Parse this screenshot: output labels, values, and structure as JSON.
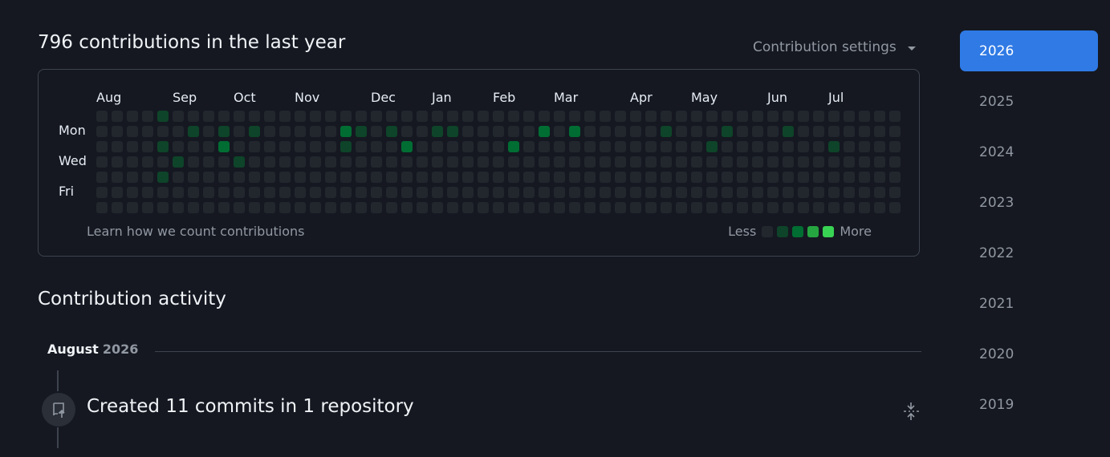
{
  "header": {
    "title": "796 contributions in the last year",
    "settings_label": "Contribution settings"
  },
  "calendar": {
    "months": [
      {
        "label": "Aug",
        "col": 0
      },
      {
        "label": "Sep",
        "col": 5
      },
      {
        "label": "Oct",
        "col": 9
      },
      {
        "label": "Nov",
        "col": 13
      },
      {
        "label": "Dec",
        "col": 18
      },
      {
        "label": "Jan",
        "col": 22
      },
      {
        "label": "Feb",
        "col": 26
      },
      {
        "label": "Mar",
        "col": 30
      },
      {
        "label": "Apr",
        "col": 35
      },
      {
        "label": "May",
        "col": 39
      },
      {
        "label": "Jun",
        "col": 44
      },
      {
        "label": "Jul",
        "col": 48
      }
    ],
    "weekdays": [
      {
        "label": "Mon",
        "row": 1
      },
      {
        "label": "Wed",
        "row": 3
      },
      {
        "label": "Fri",
        "row": 5
      }
    ],
    "colors": [
      "#22272e",
      "#0e4429",
      "#006d32",
      "#26a641",
      "#39d353"
    ],
    "levels": [
      "00001000000000000000000000000000000000000000000000000000",
      "00000010101000002101001100000202000001000100010000000000",
      "00001000200000001000200000020000000000001000000010000000",
      "00000100010000000000000000000000000000000000000000000000",
      "00001000000000000000000000000000000000000000000000000000",
      "00000000000000000000000000000000000000000000000000000000",
      "00000000000000000000000000000000000000000000000000000000"
    ],
    "learn_label": "Learn how we count contributions",
    "legend_less": "Less",
    "legend_more": "More"
  },
  "activity": {
    "title": "Contribution activity",
    "month": "August",
    "year": "2026",
    "event": "Created 11 commits in 1 repository"
  },
  "years": [
    "2026",
    "2025",
    "2024",
    "2023",
    "2022",
    "2021",
    "2020",
    "2019"
  ]
}
